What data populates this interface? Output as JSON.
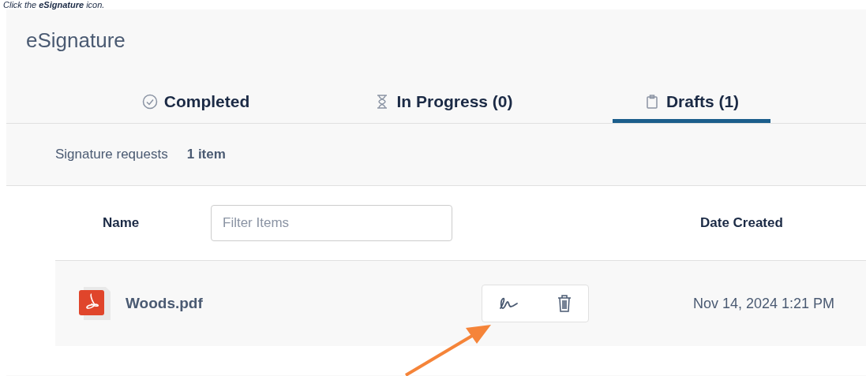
{
  "instruction": "Click the **eSignature** icon.",
  "title": "eSignature",
  "tabs": [
    {
      "label": "Completed",
      "kind": "check",
      "selected": false
    },
    {
      "label": "In Progress (0)",
      "kind": "hourglass",
      "selected": false
    },
    {
      "label": "Drafts (1)",
      "kind": "clipboard",
      "selected": true
    }
  ],
  "summary": {
    "label": "Signature requests",
    "count": "1 item"
  },
  "table": {
    "columns": [
      "Name",
      "Date Created"
    ],
    "filter": {
      "placeholder": "Filter Items"
    },
    "rows": [
      {
        "name": "Woods.pdf",
        "date": "Nov 14, 2024 1:21 PM"
      }
    ]
  }
}
